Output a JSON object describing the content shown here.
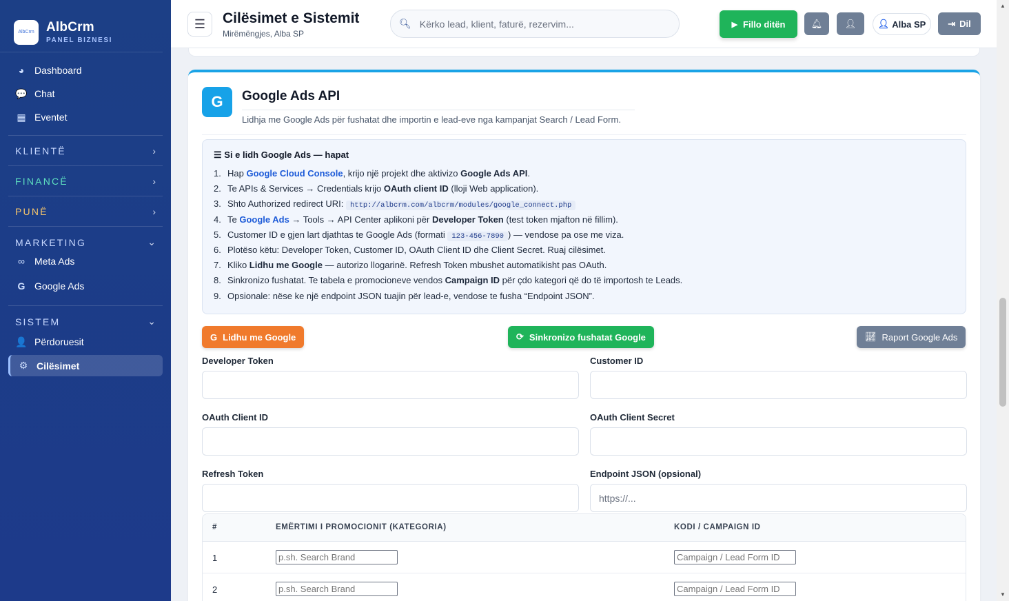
{
  "brand": {
    "logo_text": "AlbCrm",
    "name": "AlbCrm",
    "subtitle": "PANEL BIZNESI"
  },
  "sidebar": {
    "top_items": [
      {
        "label": "Dashboard",
        "icon": "dashboard-icon"
      },
      {
        "label": "Chat",
        "icon": "chat-icon"
      },
      {
        "label": "Eventet",
        "icon": "calendar-icon"
      }
    ],
    "sections": {
      "klientet": {
        "label": "KLIENTË",
        "color": "#c7d8ff"
      },
      "finance": {
        "label": "FINANCË",
        "color": "#5ee0c0"
      },
      "pune": {
        "label": "PUNË",
        "color": "#f7c66b"
      },
      "marketing": {
        "label": "MARKETING",
        "items": [
          {
            "label": "Meta Ads",
            "icon": "meta-icon"
          },
          {
            "label": "Google Ads",
            "icon": "google-icon"
          }
        ]
      },
      "sistem": {
        "label": "SISTEM",
        "items": [
          {
            "label": "Përdoruesit",
            "icon": "users-gear-icon"
          },
          {
            "label": "Cilësimet",
            "icon": "gear-icon",
            "active": true
          }
        ]
      }
    }
  },
  "header": {
    "title": "Cilësimet e Sistemit",
    "subtitle": "Mirëmëngjes, Alba SP",
    "search_placeholder": "Kërko lead, klient, faturë, rezervim...",
    "start_day": "Fillo ditën",
    "user": "Alba SP",
    "logout": "Dil",
    "colors": {
      "start": "#1fb45a",
      "icon_btn": "#6f7f96"
    }
  },
  "google_ads": {
    "title": "Google Ads API",
    "description": "Lidhja me Google Ads për fushatat dhe importin e lead-eve nga kampanjat Search / Lead Form.",
    "steps_title": "Si e lidh Google Ads — hapat",
    "steps": {
      "s1": {
        "a": "Hap ",
        "link": "Google Cloud Console",
        "b": ", krijo një projekt dhe aktivizo ",
        "bold": "Google Ads API",
        "c": "."
      },
      "s2": {
        "a": "Te APIs & Services → Credentials krijo ",
        "bold": "OAuth client ID",
        "b": " (lloji Web application)."
      },
      "s3": {
        "a": "Shto Authorized redirect URI: ",
        "code": "http://albcrm.com/albcrm/modules/google_connect.php"
      },
      "s4": {
        "a": "Te ",
        "link": "Google Ads",
        "b": " → Tools → API Center aplikoni për ",
        "bold": "Developer Token",
        "c": " (test token mjafton në fillim)."
      },
      "s5": {
        "a": "Customer ID e gjen lart djathtas te Google Ads (formati ",
        "code": "123-456-7890",
        "b": ") — vendose pa ose me viza."
      },
      "s6": {
        "a": "Plotëso këtu: Developer Token, Customer ID, OAuth Client ID dhe Client Secret. Ruaj cilësimet."
      },
      "s7": {
        "a": "Kliko ",
        "bold": "Lidhu me Google",
        "b": " — autorizo llogarinë. Refresh Token mbushet automatikisht pas OAuth."
      },
      "s8": {
        "a": "Sinkronizo fushatat. Te tabela e promocioneve vendos ",
        "bold": "Campaign ID",
        "b": " për çdo kategori që do të importosh te Leads."
      },
      "s9": {
        "a": "Opsionale: nëse ke një endpoint JSON tuajin për lead-e, vendose te fusha “Endpoint JSON”."
      }
    },
    "buttons": {
      "connect": {
        "label": "Lidhu me Google",
        "color": "#f07a2c"
      },
      "sync": {
        "label": "Sinkronizo fushatat Google",
        "color": "#1fb45a"
      },
      "report": {
        "label": "Raport Google Ads",
        "color": "#6f7f96"
      }
    },
    "fields": {
      "developer_token": {
        "label": "Developer Token",
        "value": "",
        "placeholder": ""
      },
      "customer_id": {
        "label": "Customer ID",
        "value": "",
        "placeholder": ""
      },
      "client_id": {
        "label": "OAuth Client ID",
        "value": "",
        "placeholder": ""
      },
      "client_secret": {
        "label": "OAuth Client Secret",
        "value": "",
        "placeholder": ""
      },
      "refresh_token": {
        "label": "Refresh Token",
        "value": "",
        "placeholder": ""
      },
      "endpoint": {
        "label": "Endpoint JSON (opsional)",
        "value": "",
        "placeholder": "https://..."
      }
    },
    "table": {
      "headers": {
        "num": "#",
        "name": "EMËRTIMI I PROMOCIONIT (KATEGORIA)",
        "code": "KODI / CAMPAIGN ID"
      },
      "rows": [
        {
          "num": "1",
          "name_placeholder": "p.sh. Search Brand",
          "code_placeholder": "Campaign / Lead Form ID"
        },
        {
          "num": "2",
          "name_placeholder": "p.sh. Search Brand",
          "code_placeholder": "Campaign / Lead Form ID"
        }
      ]
    }
  }
}
